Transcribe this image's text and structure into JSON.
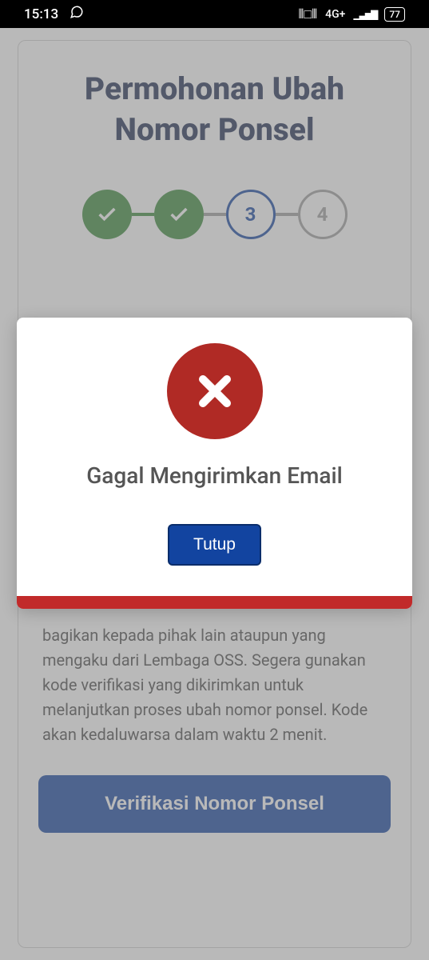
{
  "statusBar": {
    "time": "15:13",
    "network": "4G+",
    "battery": "77"
  },
  "page": {
    "title": "Permohonan Ubah Nomor Ponsel",
    "stepper": {
      "step3": "3",
      "step4": "4"
    },
    "bodyText": "bagikan kepada pihak lain ataupun yang mengaku dari Lembaga OSS. Segera gunakan kode verifikasi yang dikirimkan untuk melanjutkan proses ubah nomor ponsel. Kode akan kedaluwarsa dalam waktu 2 menit.",
    "primaryButton": "Verifikasi Nomor Ponsel"
  },
  "modal": {
    "title": "Gagal Mengirimkan Email",
    "closeButton": "Tutup"
  }
}
